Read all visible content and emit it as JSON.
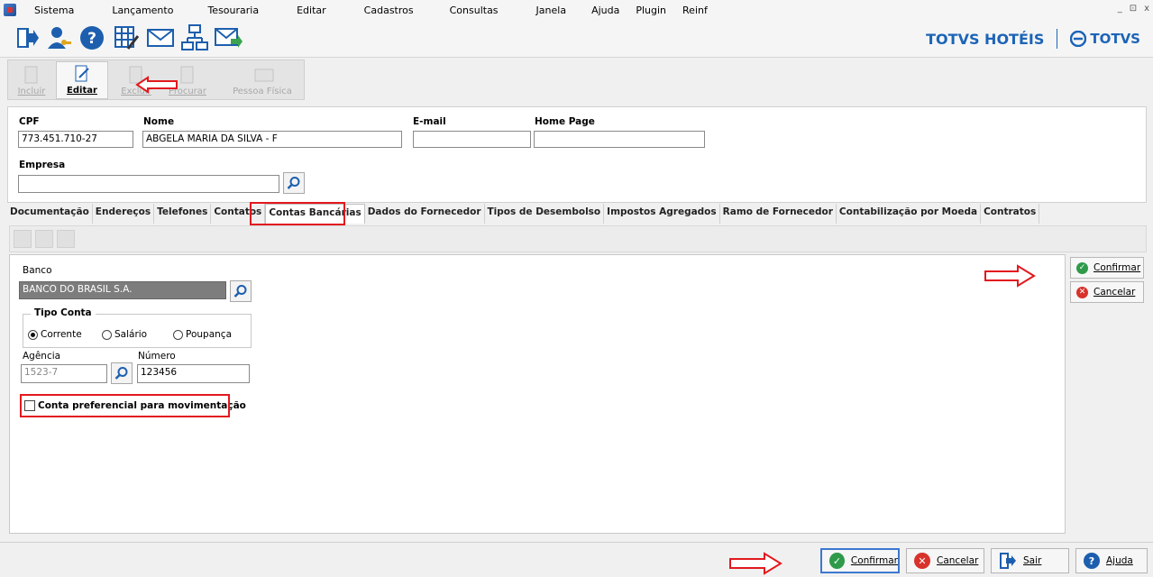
{
  "menu": [
    "Sistema",
    "Lançamento",
    "Tesouraria",
    "Editar",
    "Cadastros",
    "Consultas",
    "Janela",
    "Ajuda",
    "Plugin",
    "Reinf"
  ],
  "window_controls": [
    "_",
    "⊡",
    "x"
  ],
  "brand": {
    "left": "TOTVS HOTÉIS",
    "right": "TOTVS"
  },
  "toolbar_icons": [
    "exit-icon",
    "user-key-icon",
    "help-icon",
    "grid-edit-icon",
    "mail-icon",
    "network-icon",
    "send-mail-icon"
  ],
  "record_toolbar": {
    "incluir": "Incluir",
    "editar": "Editar",
    "excluir": "Excluir",
    "procurar": "Procurar",
    "pessoa_fisica": "Pessoa Física"
  },
  "form": {
    "cpf_label": "CPF",
    "cpf_value": "773.451.710-27",
    "nome_label": "Nome",
    "nome_value": "ABGELA MARIA DA SILVA - F",
    "email_label": "E-mail",
    "email_value": "",
    "homepage_label": "Home Page",
    "homepage_value": "",
    "empresa_label": "Empresa",
    "empresa_value": ""
  },
  "tabs": [
    "Documentação",
    "Endereços",
    "Telefones",
    "Contatos",
    "Contas Bancárias",
    "Dados do Fornecedor",
    "Tipos de Desembolso",
    "Impostos Agregados",
    "Ramo de Fornecedor",
    "Contabilização por Moeda",
    "Contratos"
  ],
  "active_tab": "Contas Bancárias",
  "bank": {
    "banco_label": "Banco",
    "banco_value": "BANCO DO BRASIL S.A.",
    "tipo_conta_label": "Tipo Conta",
    "radio_corrente": "Corrente",
    "radio_salario": "Salário",
    "radio_poupanca": "Poupança",
    "selected": "Corrente",
    "agencia_label": "Agência",
    "agencia_value": "1523-7",
    "numero_label": "Número",
    "numero_value": "123456",
    "checkbox_label": "Conta preferencial para movimentação",
    "checkbox_checked": false
  },
  "side_buttons": {
    "confirmar": "Confirmar",
    "cancelar": "Cancelar"
  },
  "bottom_buttons": {
    "confirmar": "Confirmar",
    "cancelar": "Cancelar",
    "sair": "Sair",
    "ajuda": "Ajuda"
  },
  "colors": {
    "accent": "#1c64b7",
    "annotation": "#e2191e",
    "confirm_green": "#2e9a4a",
    "cancel_red": "#d8322b"
  }
}
